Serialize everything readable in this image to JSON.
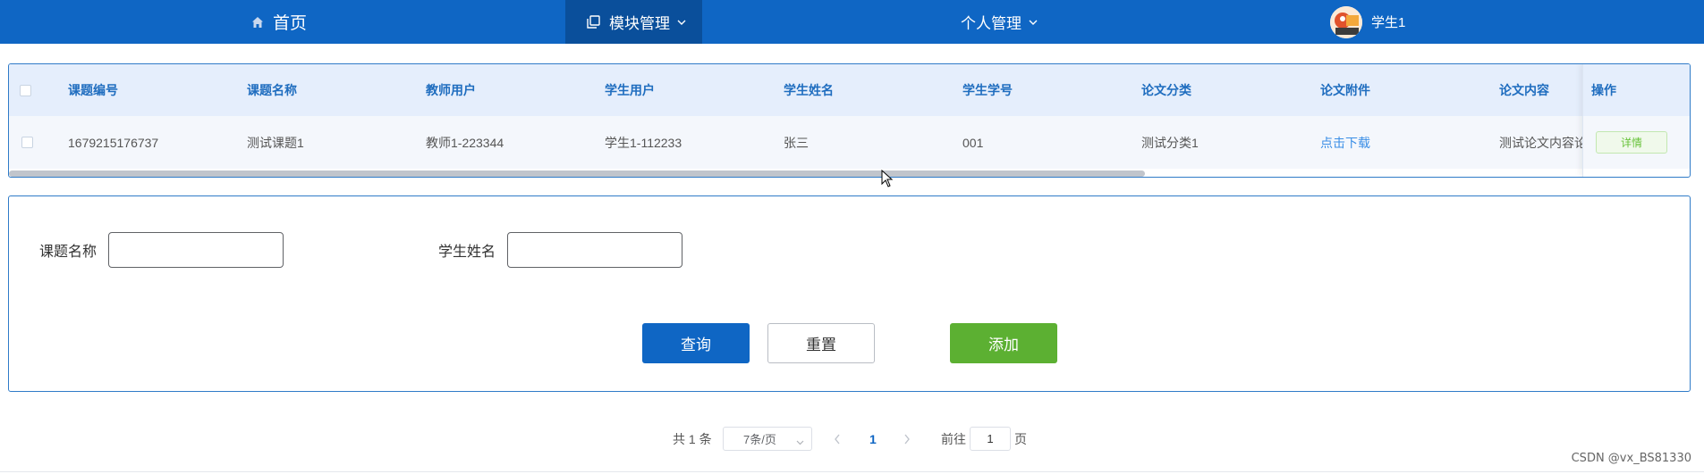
{
  "nav": {
    "home": "首页",
    "module": "模块管理",
    "personal": "个人管理",
    "user": "学生1"
  },
  "table": {
    "headers": [
      "课题编号",
      "课题名称",
      "教师用户",
      "学生用户",
      "学生姓名",
      "学生学号",
      "论文分类",
      "论文附件",
      "论文内容",
      "操作"
    ],
    "rows": [
      {
        "id": "1679215176737",
        "topic": "测试课题1",
        "teacher": "教师1-223344",
        "student_user": "学生1-112233",
        "student_name": "张三",
        "student_no": "001",
        "category": "测试分类1",
        "attachment": "点击下载",
        "content": "测试论文内容论",
        "action": "详情"
      }
    ]
  },
  "search": {
    "topic_label": "课题名称",
    "topic_value": "",
    "student_label": "学生姓名",
    "student_value": "",
    "query": "查询",
    "reset": "重置",
    "add": "添加"
  },
  "pagination": {
    "total": "共 1 条",
    "page_size": "7条/页",
    "current": "1",
    "goto_prefix": "前往",
    "goto_value": "1",
    "goto_suffix": "页"
  },
  "watermark": "CSDN @vx_BS81330",
  "colors": {
    "primary": "#0f66c4",
    "success": "#5cb032",
    "link": "#3a8ee6"
  }
}
